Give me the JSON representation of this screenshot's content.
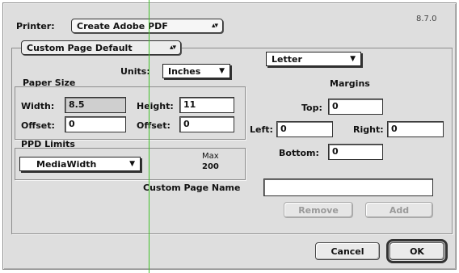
{
  "printer": {
    "label": "Printer:",
    "value": "Create Adobe PDF"
  },
  "version": "8.7.0",
  "page_default": {
    "value": "Custom Page Default"
  },
  "paper_name": {
    "value": "Letter"
  },
  "units": {
    "label": "Units:",
    "value": "Inches"
  },
  "paper_size": {
    "title": "Paper Size",
    "width_label": "Width:",
    "width_value": "8.5",
    "height_label": "Height:",
    "height_value": "11",
    "offset1_label": "Offset:",
    "offset1_value": "0",
    "offset2_label": "Offset:",
    "offset2_value": "0"
  },
  "margins": {
    "title": "Margins",
    "top_label": "Top:",
    "top_value": "0",
    "left_label": "Left:",
    "left_value": "0",
    "right_label": "Right:",
    "right_value": "0",
    "bottom_label": "Bottom:",
    "bottom_value": "0"
  },
  "ppd_limits": {
    "title": "PPD Limits",
    "select_value": "MediaWidth",
    "max_label": "Max",
    "max_value": "200"
  },
  "custom_page_name": {
    "label": "Custom Page Name",
    "value": ""
  },
  "buttons": {
    "remove": "Remove",
    "add": "Add",
    "cancel": "Cancel",
    "ok": "OK"
  },
  "icons": {
    "stepper": "up-down-arrows-icon",
    "dropdown": "triangle-down-icon"
  }
}
